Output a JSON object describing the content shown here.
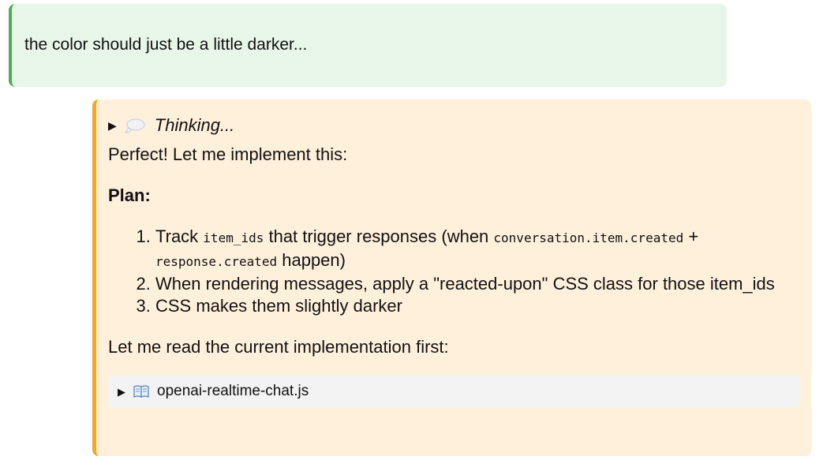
{
  "user_message": {
    "text": "the color should just be a little darker..."
  },
  "assistant_message": {
    "thinking": {
      "label": "Thinking...",
      "icon": "thought-bubble-icon",
      "toggle": "▶"
    },
    "intro": "Perfect! Let me implement this:",
    "plan_heading": "Plan:",
    "plan_items": [
      {
        "t1": "Track ",
        "c1": "item_ids",
        "t2": " that trigger responses (when ",
        "c2": "conversation.item.created",
        "t3": " + ",
        "c3": "response.created",
        "t4": " happen)"
      },
      {
        "text": "When rendering messages, apply a \"reacted-upon\" CSS class for those item_ids"
      },
      {
        "text": "CSS makes them slightly darker"
      }
    ],
    "outro": "Let me read the current implementation first:",
    "file": {
      "toggle": "▶",
      "icon": "open-book-icon",
      "name": "openai-realtime-chat.js"
    }
  },
  "colors": {
    "user_bg": "#e8f5e9",
    "user_border": "#4caf50",
    "assistant_bg": "#fff0dc",
    "assistant_border": "#f5a623",
    "file_bg": "#f3f3f3"
  }
}
